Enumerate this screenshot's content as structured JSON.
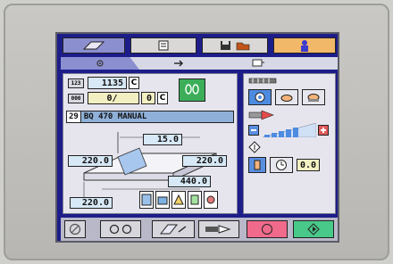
{
  "tabs": [
    {
      "icon": "eraser-icon"
    },
    {
      "icon": "document-icon"
    },
    {
      "icon": "save-folder-icon"
    },
    {
      "icon": "user-icon"
    }
  ],
  "subtabs": [
    {
      "icon": "settings-icon"
    },
    {
      "icon": "arrow-right-icon"
    },
    {
      "icon": "screen-icon"
    }
  ],
  "counters": {
    "badge_top": "123",
    "value_top": "1135",
    "flag_top": "C",
    "badge_bottom": "000",
    "value_bottom_a": "0/",
    "value_bottom_b": "0",
    "flag_bottom": "C"
  },
  "program": {
    "number": "29",
    "name": "BQ 470 MANUAL"
  },
  "dimensions": {
    "top_width": "15.0",
    "left_height": "220.0",
    "right_width": "220.0",
    "depth": "440.0",
    "bottom_left": "220.0"
  },
  "timer_value": "0.0",
  "colors": {
    "screen_bg": "#1d1d8a",
    "panel_bg": "#e6e5ee",
    "field_bg": "#d7e8f6",
    "stop_button": "#f06a8c",
    "start_button": "#48c98a",
    "user_tab": "#f1b86a"
  }
}
